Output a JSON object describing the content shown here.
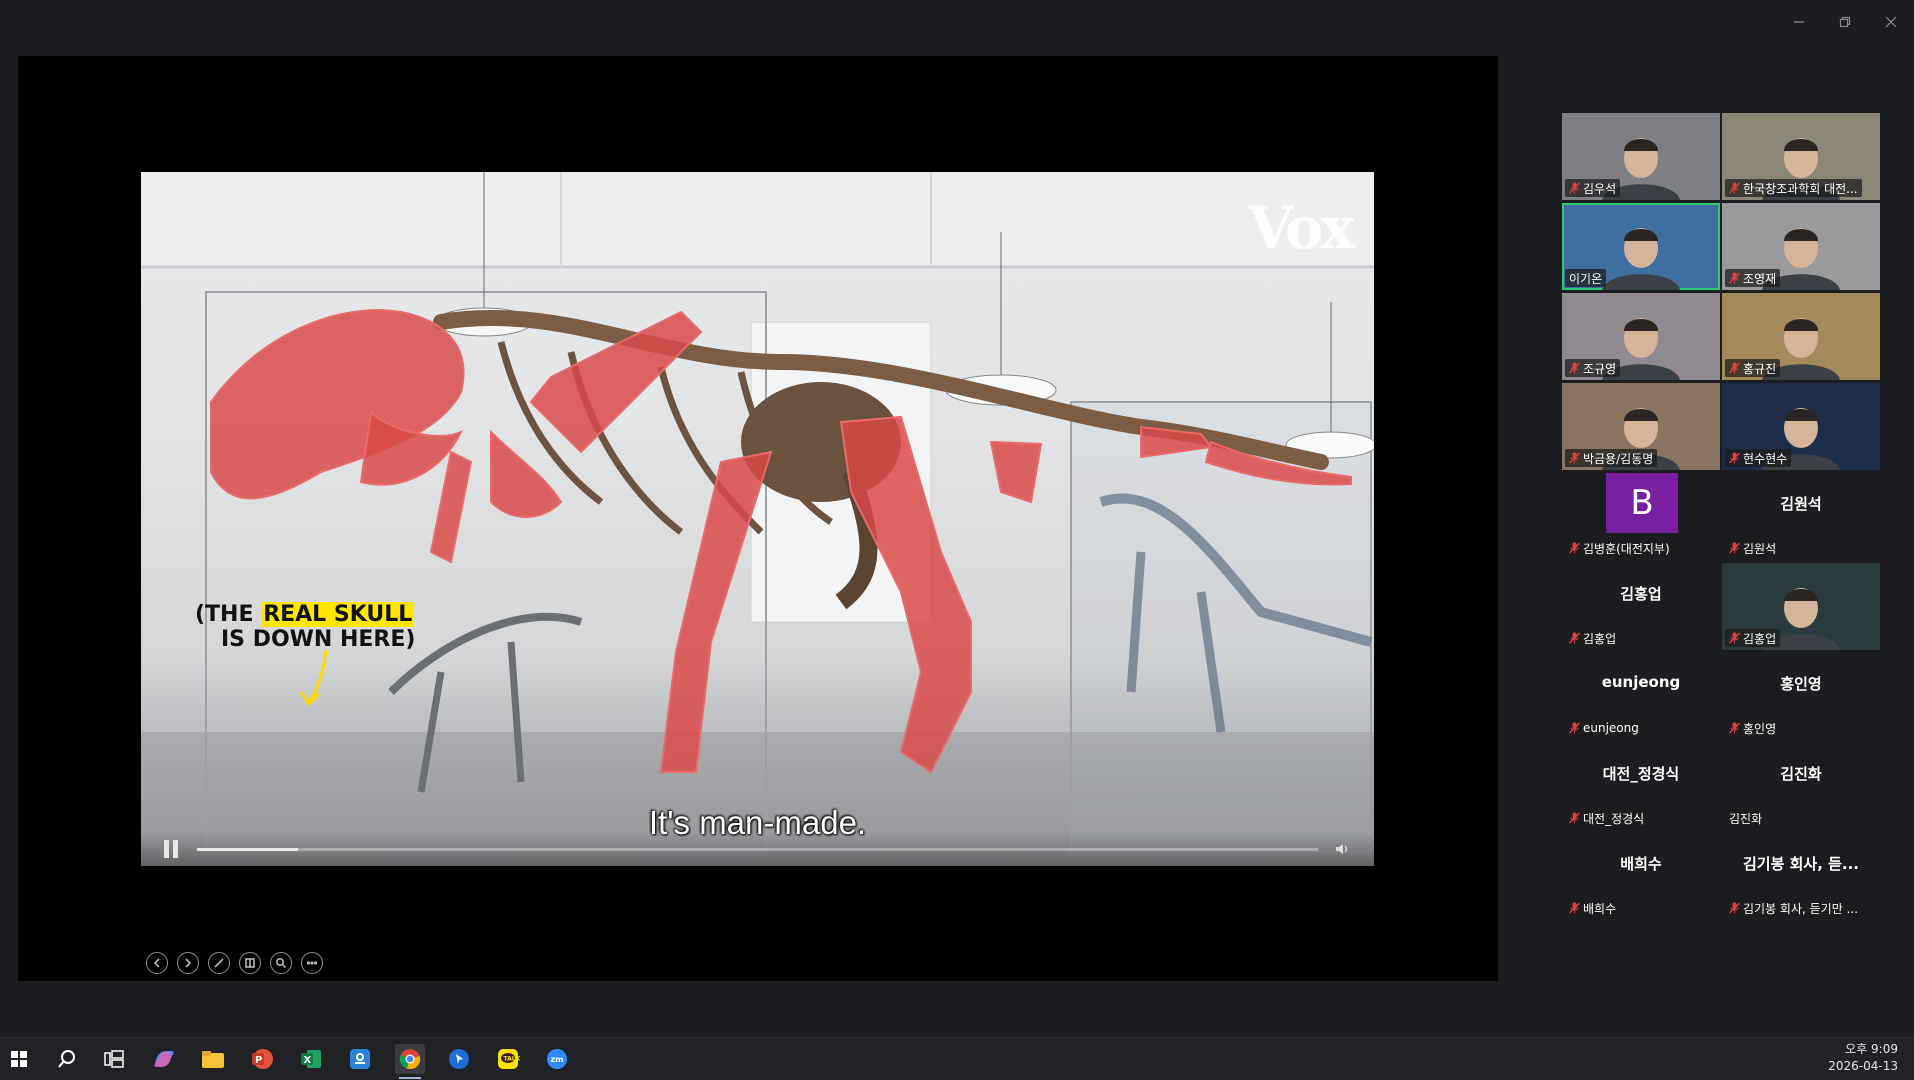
{
  "window": {
    "controls": [
      "minimize-icon",
      "restore-icon",
      "close-icon"
    ]
  },
  "video": {
    "logo": "Vox",
    "annotation_prefix": "(THE",
    "annotation_highlight": "REAL SKULL",
    "annotation_line2": "IS DOWN HERE)",
    "caption": "It's man-made.",
    "progress": 0.09
  },
  "slide_tools": [
    "prev-icon",
    "next-icon",
    "pen-icon",
    "slides-icon",
    "zoom-icon",
    "more-icon"
  ],
  "participants": [
    {
      "name": "김우석",
      "muted": true,
      "video": true
    },
    {
      "name": "한국창조과학회 대전...",
      "muted": true,
      "video": true
    },
    {
      "name": "이기온",
      "muted": false,
      "video": true,
      "active": true
    },
    {
      "name": "조영재",
      "muted": true,
      "video": true
    },
    {
      "name": "조규영",
      "muted": true,
      "video": true
    },
    {
      "name": "홍규진",
      "muted": true,
      "video": true
    },
    {
      "name": "박금용/김동명",
      "muted": true,
      "video": true
    },
    {
      "name": "현수현수",
      "muted": true,
      "video": true
    },
    {
      "name": "김병훈(대전지부)",
      "muted": true,
      "avatar_letter": "B"
    },
    {
      "name": "김원석",
      "muted": true,
      "display_name": "김원석"
    },
    {
      "name": "김홍업",
      "muted": true,
      "display_name": "김홍업"
    },
    {
      "name": "김홍업",
      "muted": true,
      "video": true
    },
    {
      "name": "eunjeong",
      "muted": true,
      "display_name": "eunjeong"
    },
    {
      "name": "홍인영",
      "muted": true,
      "display_name": "홍인영"
    },
    {
      "name": "대전_정경식",
      "muted": true,
      "display_name": "대전_정경식"
    },
    {
      "name": "김진화",
      "muted": false,
      "display_name": "김진화"
    },
    {
      "name": "배희수",
      "muted": true,
      "display_name": "배희수"
    },
    {
      "name": "김기봉 회사, 듣기만 ...",
      "muted": true,
      "display_name": "김기봉 회사, 듣..."
    }
  ],
  "taskbar": {
    "icons": [
      "start-icon",
      "search-icon",
      "task-view-icon",
      "copilot-icon",
      "file-explorer-icon",
      "powerpoint-icon",
      "excel-icon",
      "hancom-icon",
      "chrome-icon",
      "pin-icon",
      "kakaotalk-icon",
      "zoom-icon"
    ],
    "clock_time": "오후 9:09",
    "clock_date": "2026-04-13"
  }
}
